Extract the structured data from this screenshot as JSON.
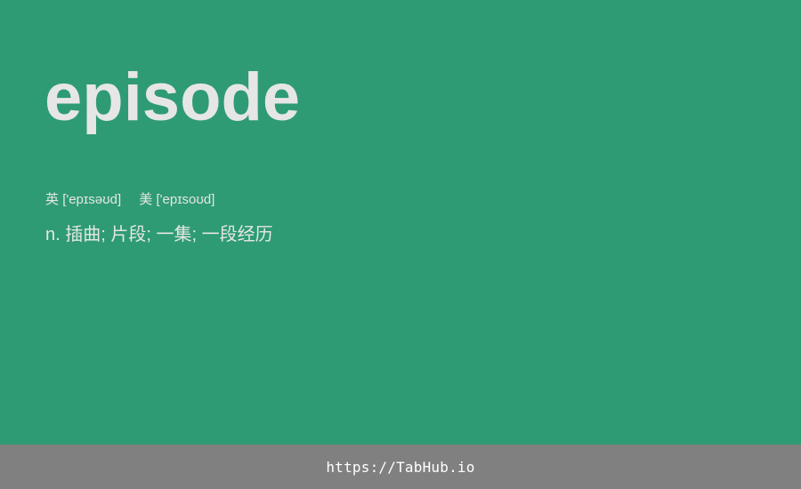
{
  "card": {
    "word": "episode",
    "phonetics": {
      "uk_label": "英",
      "uk_ipa": "['epɪsəʊd]",
      "us_label": "美",
      "us_ipa": "['epɪsoʊd]"
    },
    "definition": "n. 插曲; 片段; 一集; 一段经历"
  },
  "footer": {
    "link_text": "https://TabHub.io"
  },
  "colors": {
    "background": "#2e9b74",
    "text": "#e6e6e6",
    "footer_background": "#808080",
    "footer_text": "#ffffff"
  }
}
